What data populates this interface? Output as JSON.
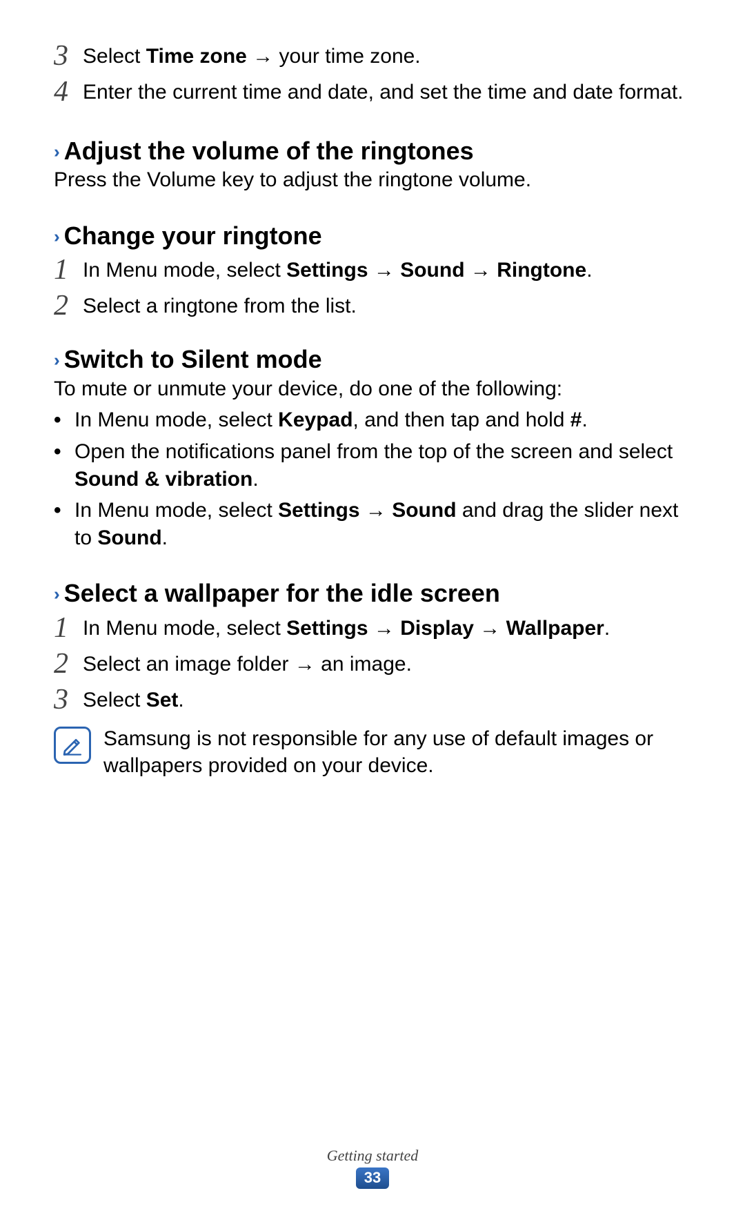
{
  "top_steps": [
    {
      "num": "3",
      "html": "Select <b>Time zone</b> <span class='arrow'></span> your time zone."
    },
    {
      "num": "4",
      "html": "Enter the current time and date, and set the time and date format."
    }
  ],
  "sections": [
    {
      "title": "Adjust the volume of the ringtones",
      "body_html": "Press the Volume key to adjust the ringtone volume."
    },
    {
      "title": "Change your ringtone",
      "steps": [
        {
          "num": "1",
          "html": "In Menu mode, select <b>Settings</b> <span class='arrow'></span> <b>Sound</b> <span class='arrow'></span> <b>Ringtone</b>."
        },
        {
          "num": "2",
          "html": "Select a ringtone from the list."
        }
      ]
    },
    {
      "title": "Switch to Silent mode",
      "body_html": "To mute or unmute your device, do one of the following:",
      "bullets": [
        "In Menu mode, select <b>Keypad</b>, and then tap and hold <b>#</b>.",
        "Open the notifications panel from the top of the screen and select <b>Sound & vibration</b>.",
        "In Menu mode, select <b>Settings</b> <span class='arrow'></span> <b>Sound</b> and drag the slider next to <b>Sound</b>."
      ]
    },
    {
      "title": "Select a wallpaper for the idle screen",
      "steps": [
        {
          "num": "1",
          "html": "In Menu mode, select <b>Settings</b> <span class='arrow'></span> <b>Display</b> <span class='arrow'></span> <b>Wallpaper</b>."
        },
        {
          "num": "2",
          "html": "Select an image folder <span class='arrow'></span> an image."
        },
        {
          "num": "3",
          "html": "Select <b>Set</b>."
        }
      ],
      "note_html": "Samsung is not responsible for any use of default images or wallpapers provided on your device."
    }
  ],
  "footer": {
    "title": "Getting started",
    "page": "33"
  },
  "chevrons": "››"
}
